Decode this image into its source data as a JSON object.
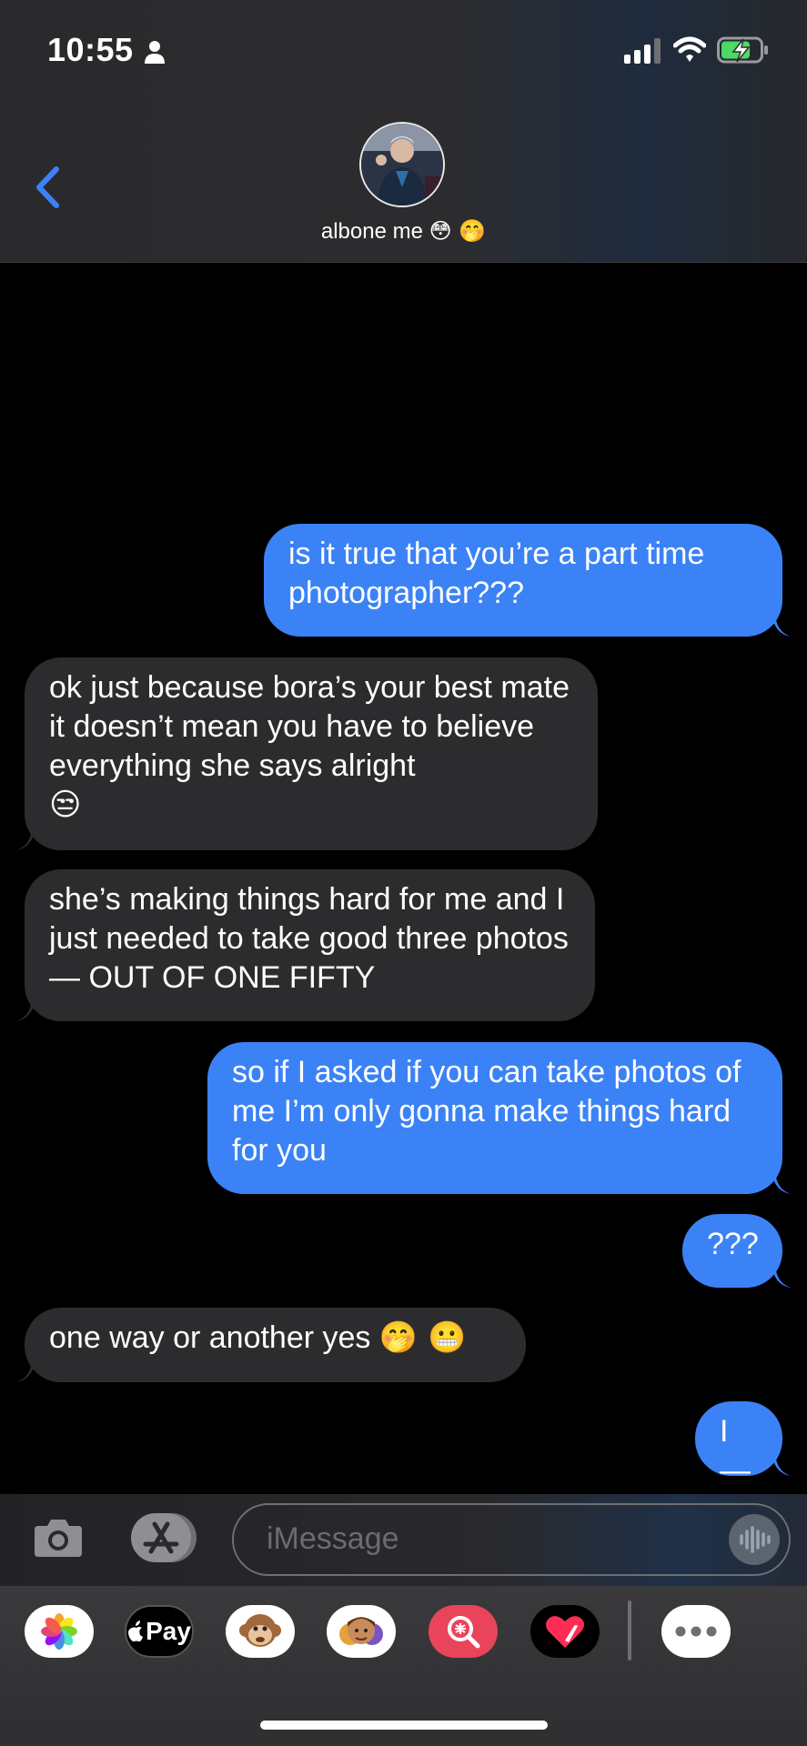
{
  "status_bar": {
    "time": "10:55"
  },
  "contact": {
    "name": "albone me",
    "emojis": "😳 🤭"
  },
  "messages": [
    {
      "side": "out",
      "text": "is it true that you’re a part time photographer???"
    },
    {
      "side": "in",
      "text": "ok just because bora’s your best mate it doesn’t mean you have to believe everything she says alright",
      "emoji": "😒"
    },
    {
      "side": "in",
      "text": "she’s making things hard for me and I just needed to take good three photos— OUT OF ONE FIFTY"
    },
    {
      "side": "out",
      "text": "so if I asked if you can take photos of me I’m only gonna make things hard for you"
    },
    {
      "side": "out",
      "text": "???"
    },
    {
      "side": "in",
      "text": "one way or another yes",
      "emoji": "🤭 😬"
    },
    {
      "side": "out",
      "text": "I—"
    }
  ],
  "compose": {
    "placeholder": "iMessage"
  },
  "tray": {
    "apple_pay_label": "Pay",
    "apps": [
      "photos-icon",
      "apple-pay-icon",
      "memoji-monkey-icon",
      "memoji-icon",
      "images-search-icon",
      "digital-touch-icon",
      "more-apps-icon"
    ]
  },
  "colors": {
    "outgoing_bubble": "#3b82f6",
    "incoming_bubble": "#2c2c2e",
    "accent": "#3b82f6"
  }
}
